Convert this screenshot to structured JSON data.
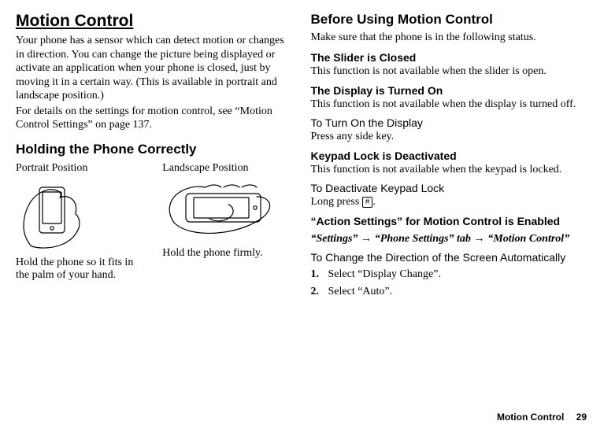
{
  "left": {
    "title": "Motion Control",
    "intro1": "Your phone has a sensor which can detect motion or changes in direction. You can change the picture being displayed or activate an application when your phone is closed, just by moving it in a certain way. (This is available in portrait and landscape position.)",
    "intro2": "For details on the settings for motion control, see “Motion Control Settings” on page 137.",
    "holding_title": "Holding the Phone Correctly",
    "portrait_label": "Portrait Position",
    "landscape_label": "Landscape Position",
    "portrait_caption": "Hold the phone so it fits in the palm of your hand.",
    "landscape_caption": "Hold the phone firmly."
  },
  "right": {
    "before_title": "Before Using Motion Control",
    "before_intro": "Make sure that the phone is in the following status.",
    "slider_h": "The Slider is Closed",
    "slider_b": "This function is not available when the slider is open.",
    "display_h": "The Display is Turned On",
    "display_b": "This function is not available when the display is turned off.",
    "turn_on_h": "To Turn On the Display",
    "turn_on_b": "Press any side key.",
    "keypad_h": "Keypad Lock is Deactivated",
    "keypad_b": "This function is not available when the keypad is locked.",
    "deact_h": "To Deactivate Keypad Lock",
    "deact_b_prefix": "Long press ",
    "deact_key": "#",
    "deact_b_suffix": ".",
    "action_h": "“Action Settings” for Motion Control is Enabled",
    "nav_1": "“Settings”",
    "nav_2": "“Phone Settings” tab",
    "nav_3": "“Motion Control”",
    "auto_h": "To Change the Direction of the Screen Automatically",
    "step1": "Select “Display Change”.",
    "step2": "Select “Auto”."
  },
  "footer": {
    "section": "Motion Control",
    "page": "29"
  }
}
